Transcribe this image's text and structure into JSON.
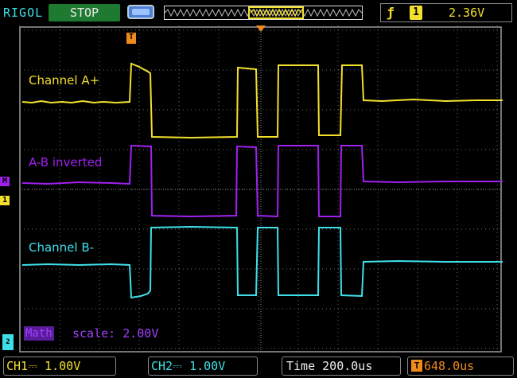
{
  "header": {
    "brand": "RIGOL",
    "run_status": "STOP",
    "trigger_source": "1",
    "trigger_level": "2.36V",
    "icons": {
      "usb": "usb-storage-icon",
      "trigger_edge": "rising-edge-icon"
    }
  },
  "traces": [
    {
      "name": "Channel A+",
      "color": "#f2e02c"
    },
    {
      "name": "A-B inverted",
      "color": "#a020f0"
    },
    {
      "name": "Channel B-",
      "color": "#3ee0e8"
    }
  ],
  "math": {
    "tag": "Math",
    "scale_text": "scale: 2.00V"
  },
  "markers": {
    "math": "M",
    "ch1": "1",
    "ch2": "2",
    "trigger": "T"
  },
  "footer": {
    "ch1": "CH1⎓  1.00V",
    "ch2": "CH2⎓  1.00V",
    "time": "Time 200.0us",
    "trigger_offset": "648.0us"
  },
  "colors": {
    "ch1": "#f2e02c",
    "ch2": "#3ee0e8",
    "math": "#a020f0",
    "trigger": "#f08a1c",
    "stop": "#1e7a30"
  }
}
